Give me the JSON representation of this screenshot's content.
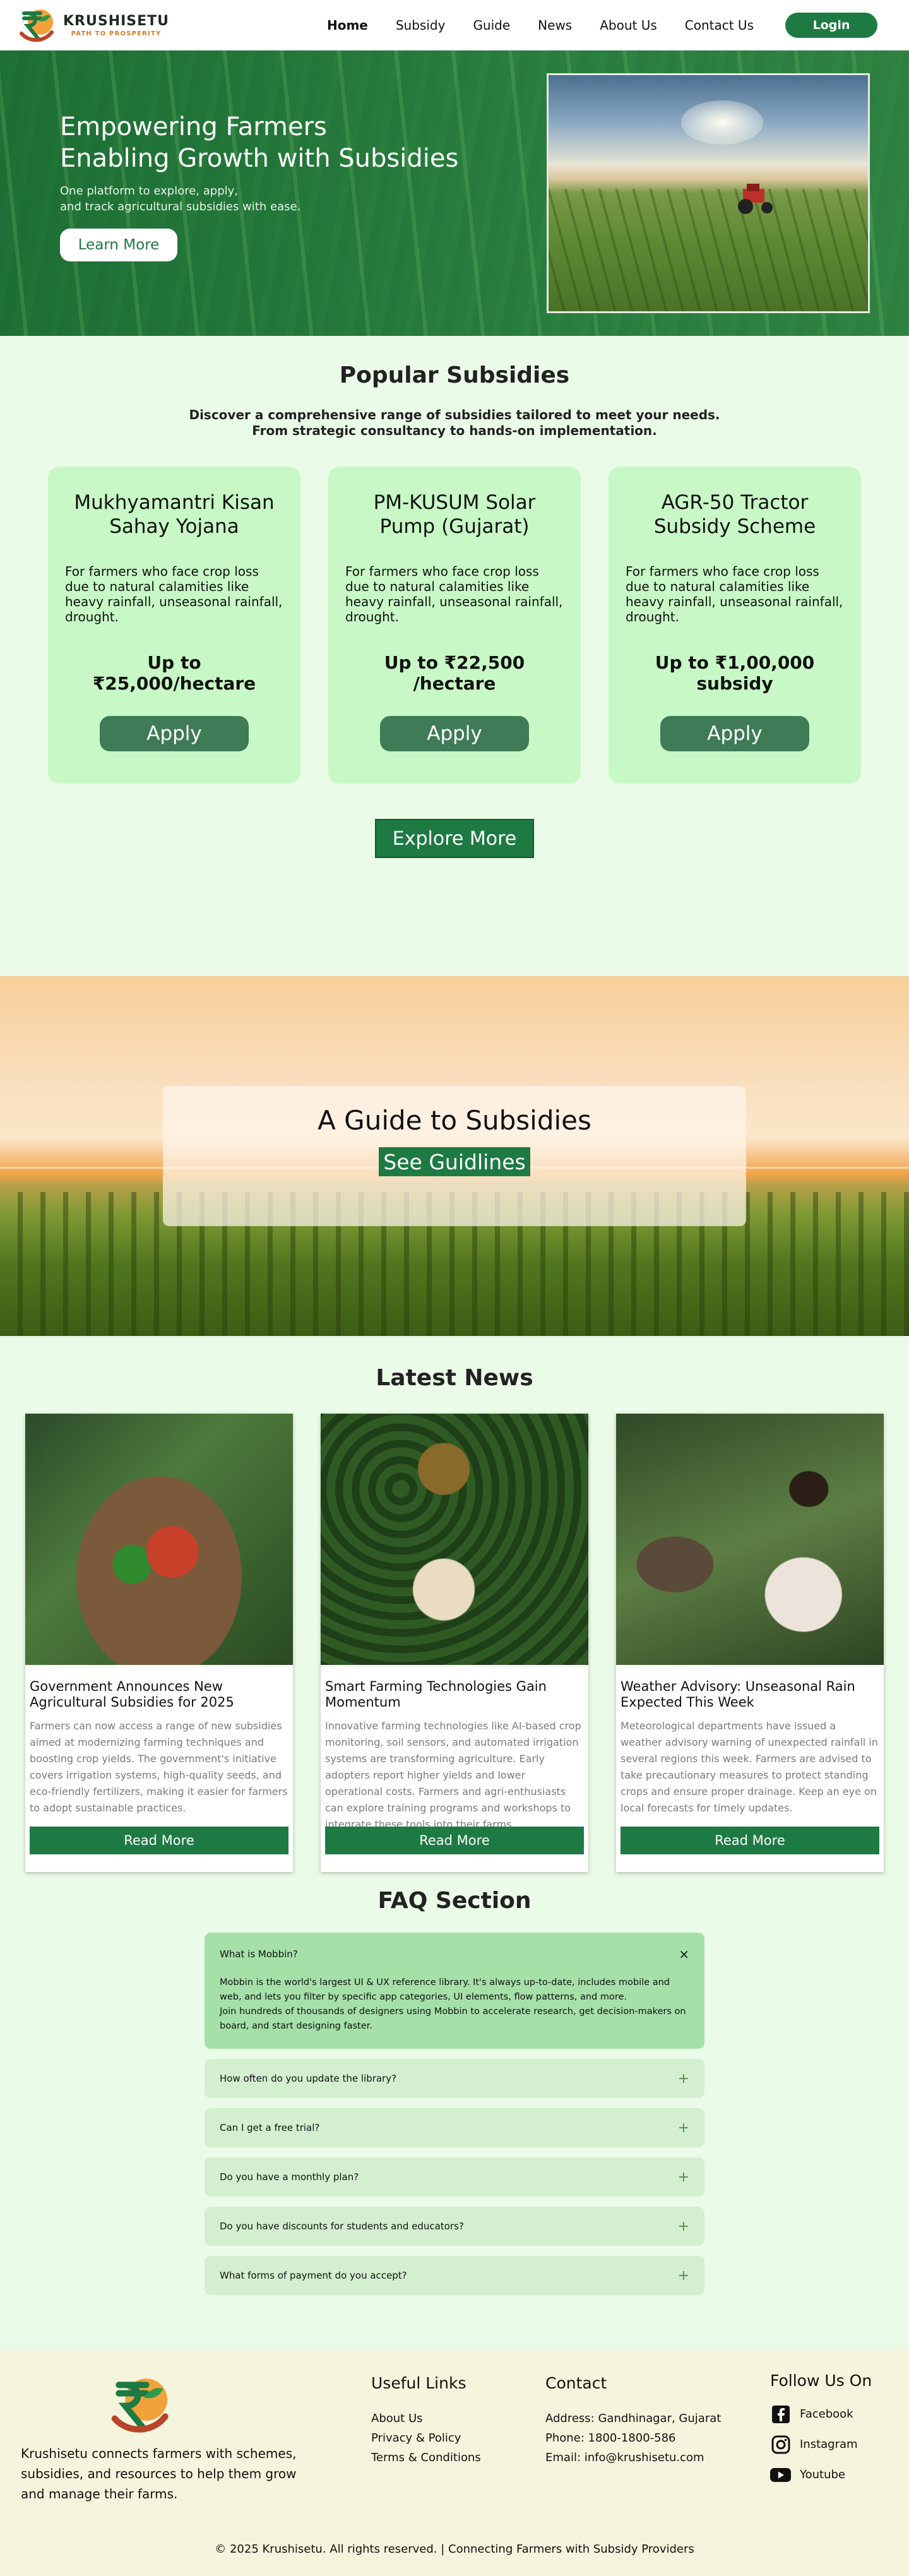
{
  "nav": {
    "brand_name": "KRUSHISETU",
    "brand_tagline": "PATH TO PROSPERITY",
    "links": [
      "Home",
      "Subsidy",
      "Guide",
      "News",
      "About Us",
      "Contact Us"
    ],
    "login": "Login"
  },
  "hero": {
    "title_line1": "Empowering Farmers",
    "title_line2": "Enabling Growth with Subsidies",
    "desc_line1": "One platform to explore, apply,",
    "desc_line2": "and track agricultural subsidies with ease.",
    "cta": "Learn More"
  },
  "popular": {
    "title": "Popular Subsidies",
    "sub_line1": "Discover a comprehensive range of subsidies tailored to meet your needs.",
    "sub_line2": "From strategic consultancy to hands-on implementation.",
    "cards": [
      {
        "title": "Mukhyamantri Kisan Sahay Yojana",
        "desc": "For farmers who face crop loss due to natural calamities like heavy rainfall, unseasonal rainfall, drought.",
        "amount": "Up to ₹25,000/hectare",
        "cta": "Apply"
      },
      {
        "title": "PM-KUSUM Solar Pump (Gujarat)",
        "desc": "For farmers who face crop loss due to natural calamities like heavy rainfall, unseasonal rainfall, drought.",
        "amount": "Up to ₹22,500 /hectare",
        "cta": "Apply"
      },
      {
        "title": "AGR-50 Tractor Subsidy Scheme",
        "desc": "For farmers who face crop loss due to natural calamities like heavy rainfall, unseasonal rainfall, drought.",
        "amount": "Up to ₹1,00,000 subsidy",
        "cta": "Apply"
      }
    ],
    "explore": "Explore More"
  },
  "guide": {
    "title": "A Guide to Subsidies",
    "cta": "See Guidlines"
  },
  "news": {
    "title": "Latest News",
    "items": [
      {
        "title": " Government Announces New Agricultural Subsidies for 2025",
        "body": "Farmers can now access a range of new subsidies aimed at modernizing farming techniques and boosting crop yields. The government's initiative covers irrigation systems, high-quality seeds, and eco-friendly fertilizers, making it easier for farmers to adopt sustainable practices.",
        "cta": "Read More"
      },
      {
        "title": "Smart Farming Technologies Gain Momentum",
        "body": "Innovative farming technologies like AI-based crop monitoring, soil sensors, and automated irrigation systems are transforming agriculture. Early adopters report higher yields and lower operational costs. Farmers and agri-enthusiasts can explore training programs and workshops to integrate these tools into their farms.",
        "cta": "Read More"
      },
      {
        "title": "Weather Advisory: Unseasonal Rain Expected This Week",
        "body": "Meteorological departments have issued a weather advisory warning of unexpected rainfall in several regions this week. Farmers are advised to take precautionary measures to protect standing crops and ensure proper drainage. Keep an eye on local forecasts for timely updates.",
        "cta": "Read More"
      }
    ]
  },
  "faq": {
    "title": "FAQ Section",
    "open_question": "What is Mobbin?",
    "open_icon": "×",
    "open_answer_p1": "Mobbin is the world's largest UI & UX reference library. It's always up-to-date, includes mobile and web, and lets you filter by specific app categories, UI elements, flow patterns, and more.",
    "open_answer_p2": "Join hundreds of thousands of designers using Mobbin to accelerate research, get decision-makers on board, and start designing faster.",
    "closed_icon": "+",
    "questions": [
      "How often do you update the library?",
      "Can I get a free trial?",
      "Do you have a monthly plan?",
      "Do you have discounts for students and educators?",
      "What forms of payment do you accept?"
    ]
  },
  "footer": {
    "about": "Krushisetu connects farmers with schemes, subsidies, and resources to help them grow and manage their farms.",
    "links_title": "Useful Links",
    "links": [
      "About Us",
      "Privacy & Policy",
      "Terms & Conditions"
    ],
    "contact_title": "Contact",
    "address": "Address: Gandhinagar, Gujarat",
    "phone": "Phone: 1800-1800-586",
    "email": "Email: info@krushisetu.com",
    "social_title": "Follow Us On",
    "social": [
      "Facebook",
      "Instagram",
      "Youtube"
    ],
    "copyright": "© 2025 Krushisetu. All rights reserved. | Connecting Farmers with Subsidy Providers"
  },
  "colors": {
    "primary": "#1d7a43",
    "card": "#c7f8c5",
    "page": "#eafbe7",
    "footer": "#f5f4dc",
    "accent": "#d9791f"
  }
}
